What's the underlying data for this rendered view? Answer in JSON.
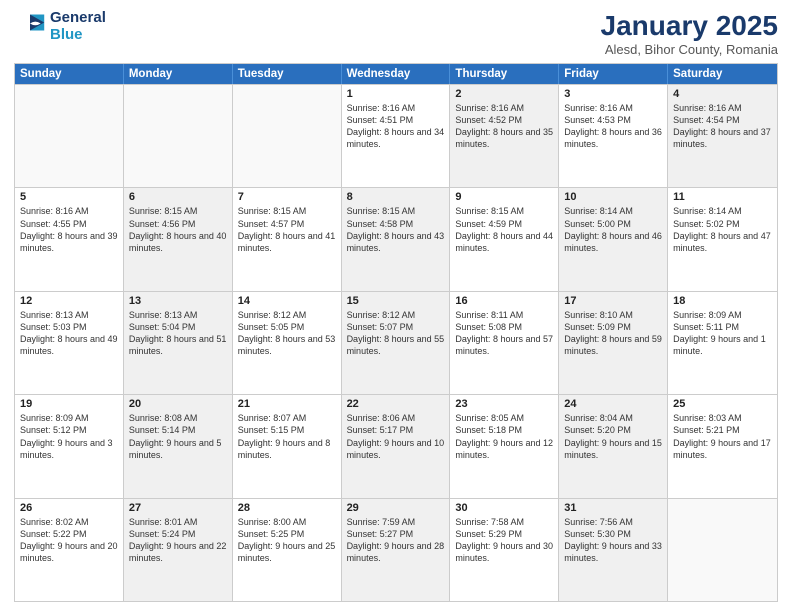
{
  "logo": {
    "line1": "General",
    "line2": "Blue"
  },
  "title": "January 2025",
  "subtitle": "Alesd, Bihor County, Romania",
  "headers": [
    "Sunday",
    "Monday",
    "Tuesday",
    "Wednesday",
    "Thursday",
    "Friday",
    "Saturday"
  ],
  "weeks": [
    [
      {
        "day": "",
        "sunrise": "",
        "sunset": "",
        "daylight": "",
        "shaded": false,
        "empty": true
      },
      {
        "day": "",
        "sunrise": "",
        "sunset": "",
        "daylight": "",
        "shaded": false,
        "empty": true
      },
      {
        "day": "",
        "sunrise": "",
        "sunset": "",
        "daylight": "",
        "shaded": false,
        "empty": true
      },
      {
        "day": "1",
        "sunrise": "Sunrise: 8:16 AM",
        "sunset": "Sunset: 4:51 PM",
        "daylight": "Daylight: 8 hours and 34 minutes.",
        "shaded": false,
        "empty": false
      },
      {
        "day": "2",
        "sunrise": "Sunrise: 8:16 AM",
        "sunset": "Sunset: 4:52 PM",
        "daylight": "Daylight: 8 hours and 35 minutes.",
        "shaded": true,
        "empty": false
      },
      {
        "day": "3",
        "sunrise": "Sunrise: 8:16 AM",
        "sunset": "Sunset: 4:53 PM",
        "daylight": "Daylight: 8 hours and 36 minutes.",
        "shaded": false,
        "empty": false
      },
      {
        "day": "4",
        "sunrise": "Sunrise: 8:16 AM",
        "sunset": "Sunset: 4:54 PM",
        "daylight": "Daylight: 8 hours and 37 minutes.",
        "shaded": true,
        "empty": false
      }
    ],
    [
      {
        "day": "5",
        "sunrise": "Sunrise: 8:16 AM",
        "sunset": "Sunset: 4:55 PM",
        "daylight": "Daylight: 8 hours and 39 minutes.",
        "shaded": false,
        "empty": false
      },
      {
        "day": "6",
        "sunrise": "Sunrise: 8:15 AM",
        "sunset": "Sunset: 4:56 PM",
        "daylight": "Daylight: 8 hours and 40 minutes.",
        "shaded": true,
        "empty": false
      },
      {
        "day": "7",
        "sunrise": "Sunrise: 8:15 AM",
        "sunset": "Sunset: 4:57 PM",
        "daylight": "Daylight: 8 hours and 41 minutes.",
        "shaded": false,
        "empty": false
      },
      {
        "day": "8",
        "sunrise": "Sunrise: 8:15 AM",
        "sunset": "Sunset: 4:58 PM",
        "daylight": "Daylight: 8 hours and 43 minutes.",
        "shaded": true,
        "empty": false
      },
      {
        "day": "9",
        "sunrise": "Sunrise: 8:15 AM",
        "sunset": "Sunset: 4:59 PM",
        "daylight": "Daylight: 8 hours and 44 minutes.",
        "shaded": false,
        "empty": false
      },
      {
        "day": "10",
        "sunrise": "Sunrise: 8:14 AM",
        "sunset": "Sunset: 5:00 PM",
        "daylight": "Daylight: 8 hours and 46 minutes.",
        "shaded": true,
        "empty": false
      },
      {
        "day": "11",
        "sunrise": "Sunrise: 8:14 AM",
        "sunset": "Sunset: 5:02 PM",
        "daylight": "Daylight: 8 hours and 47 minutes.",
        "shaded": false,
        "empty": false
      }
    ],
    [
      {
        "day": "12",
        "sunrise": "Sunrise: 8:13 AM",
        "sunset": "Sunset: 5:03 PM",
        "daylight": "Daylight: 8 hours and 49 minutes.",
        "shaded": false,
        "empty": false
      },
      {
        "day": "13",
        "sunrise": "Sunrise: 8:13 AM",
        "sunset": "Sunset: 5:04 PM",
        "daylight": "Daylight: 8 hours and 51 minutes.",
        "shaded": true,
        "empty": false
      },
      {
        "day": "14",
        "sunrise": "Sunrise: 8:12 AM",
        "sunset": "Sunset: 5:05 PM",
        "daylight": "Daylight: 8 hours and 53 minutes.",
        "shaded": false,
        "empty": false
      },
      {
        "day": "15",
        "sunrise": "Sunrise: 8:12 AM",
        "sunset": "Sunset: 5:07 PM",
        "daylight": "Daylight: 8 hours and 55 minutes.",
        "shaded": true,
        "empty": false
      },
      {
        "day": "16",
        "sunrise": "Sunrise: 8:11 AM",
        "sunset": "Sunset: 5:08 PM",
        "daylight": "Daylight: 8 hours and 57 minutes.",
        "shaded": false,
        "empty": false
      },
      {
        "day": "17",
        "sunrise": "Sunrise: 8:10 AM",
        "sunset": "Sunset: 5:09 PM",
        "daylight": "Daylight: 8 hours and 59 minutes.",
        "shaded": true,
        "empty": false
      },
      {
        "day": "18",
        "sunrise": "Sunrise: 8:09 AM",
        "sunset": "Sunset: 5:11 PM",
        "daylight": "Daylight: 9 hours and 1 minute.",
        "shaded": false,
        "empty": false
      }
    ],
    [
      {
        "day": "19",
        "sunrise": "Sunrise: 8:09 AM",
        "sunset": "Sunset: 5:12 PM",
        "daylight": "Daylight: 9 hours and 3 minutes.",
        "shaded": false,
        "empty": false
      },
      {
        "day": "20",
        "sunrise": "Sunrise: 8:08 AM",
        "sunset": "Sunset: 5:14 PM",
        "daylight": "Daylight: 9 hours and 5 minutes.",
        "shaded": true,
        "empty": false
      },
      {
        "day": "21",
        "sunrise": "Sunrise: 8:07 AM",
        "sunset": "Sunset: 5:15 PM",
        "daylight": "Daylight: 9 hours and 8 minutes.",
        "shaded": false,
        "empty": false
      },
      {
        "day": "22",
        "sunrise": "Sunrise: 8:06 AM",
        "sunset": "Sunset: 5:17 PM",
        "daylight": "Daylight: 9 hours and 10 minutes.",
        "shaded": true,
        "empty": false
      },
      {
        "day": "23",
        "sunrise": "Sunrise: 8:05 AM",
        "sunset": "Sunset: 5:18 PM",
        "daylight": "Daylight: 9 hours and 12 minutes.",
        "shaded": false,
        "empty": false
      },
      {
        "day": "24",
        "sunrise": "Sunrise: 8:04 AM",
        "sunset": "Sunset: 5:20 PM",
        "daylight": "Daylight: 9 hours and 15 minutes.",
        "shaded": true,
        "empty": false
      },
      {
        "day": "25",
        "sunrise": "Sunrise: 8:03 AM",
        "sunset": "Sunset: 5:21 PM",
        "daylight": "Daylight: 9 hours and 17 minutes.",
        "shaded": false,
        "empty": false
      }
    ],
    [
      {
        "day": "26",
        "sunrise": "Sunrise: 8:02 AM",
        "sunset": "Sunset: 5:22 PM",
        "daylight": "Daylight: 9 hours and 20 minutes.",
        "shaded": false,
        "empty": false
      },
      {
        "day": "27",
        "sunrise": "Sunrise: 8:01 AM",
        "sunset": "Sunset: 5:24 PM",
        "daylight": "Daylight: 9 hours and 22 minutes.",
        "shaded": true,
        "empty": false
      },
      {
        "day": "28",
        "sunrise": "Sunrise: 8:00 AM",
        "sunset": "Sunset: 5:25 PM",
        "daylight": "Daylight: 9 hours and 25 minutes.",
        "shaded": false,
        "empty": false
      },
      {
        "day": "29",
        "sunrise": "Sunrise: 7:59 AM",
        "sunset": "Sunset: 5:27 PM",
        "daylight": "Daylight: 9 hours and 28 minutes.",
        "shaded": true,
        "empty": false
      },
      {
        "day": "30",
        "sunrise": "Sunrise: 7:58 AM",
        "sunset": "Sunset: 5:29 PM",
        "daylight": "Daylight: 9 hours and 30 minutes.",
        "shaded": false,
        "empty": false
      },
      {
        "day": "31",
        "sunrise": "Sunrise: 7:56 AM",
        "sunset": "Sunset: 5:30 PM",
        "daylight": "Daylight: 9 hours and 33 minutes.",
        "shaded": true,
        "empty": false
      },
      {
        "day": "",
        "sunrise": "",
        "sunset": "",
        "daylight": "",
        "shaded": false,
        "empty": true
      }
    ]
  ]
}
